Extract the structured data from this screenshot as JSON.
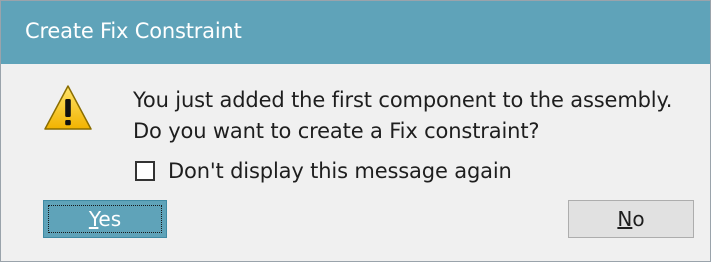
{
  "dialog": {
    "title": "Create Fix Constraint",
    "icon": "warning-icon",
    "message_line1": "You just added the first component to the assembly.",
    "message_line2": "Do you want to create a Fix constraint?",
    "checkbox": {
      "label": "Don't display this message again",
      "checked": false
    },
    "buttons": {
      "yes_label": "Yes",
      "no_label": "No"
    }
  },
  "colors": {
    "titlebar": "#5fa3b9",
    "primary_button": "#5fa3b9",
    "background": "#f0f0f0",
    "warning_yellow": "#f5c400"
  }
}
